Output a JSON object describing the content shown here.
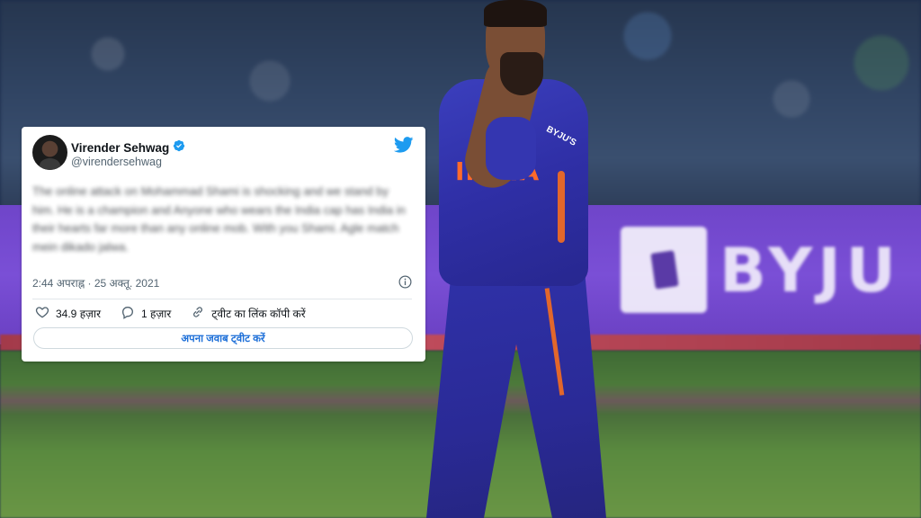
{
  "tweet": {
    "display_name": "Virender Sehwag",
    "handle": "@virendersehwag",
    "text": "The online attack on Mohammad Shami is shocking and we stand by him. He is a champion and Anyone who wears the India cap has India in their hearts far more than any online mob. With you Shami. Agle match mein dikado jalwa.",
    "timestamp": "2:44 अपराह्न · 25 अक्तू. 2021",
    "likes": "34.9 हज़ार",
    "replies": "1 हज़ार",
    "copy_link": "ट्वीट का लिंक कॉपी करें",
    "reply_button": "अपना जवाब ट्वीट करें",
    "icons": {
      "verified": "verified-badge-icon",
      "logo": "twitter-bird-icon",
      "info": "info-icon",
      "like": "heart-icon",
      "reply": "comment-bubble-icon",
      "link": "link-icon"
    }
  },
  "background": {
    "jersey_text": "INDIA",
    "sponsor_chest": "BYJU'S",
    "board_text": "BYJU"
  },
  "colors": {
    "twitter_blue": "#1d9bf0",
    "board_purple": "#7a4fd6",
    "jersey_blue": "#2f2fa6"
  }
}
